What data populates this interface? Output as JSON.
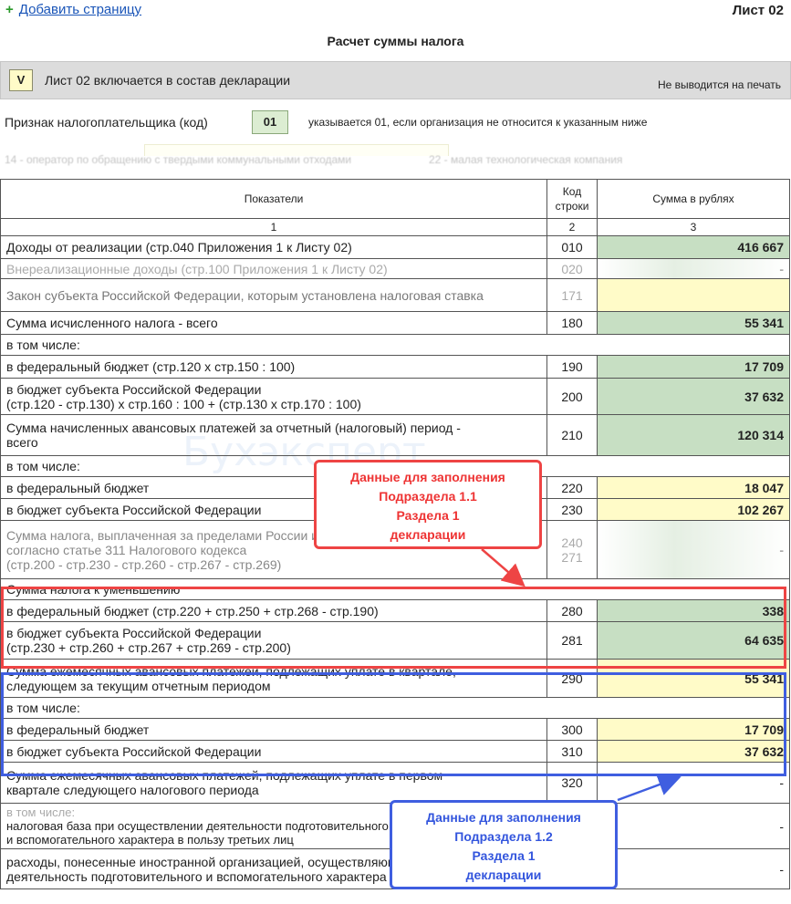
{
  "toolbar": {
    "add_page_icon": "plus-icon",
    "add_page_label": "Добавить страницу",
    "sheet_label": "Лист 02"
  },
  "title": "Расчет суммы налога",
  "include": {
    "checkbox_value": "V",
    "label": "Лист 02 включается в состав декларации",
    "noprint": "Не выводится на печать"
  },
  "taxpayer": {
    "label": "Признак налогоплательщика (код)",
    "code": "01",
    "hint": "указывается 01, если организация не относится к указанным ниже"
  },
  "faded_hints": {
    "left": "14 - оператор по обращению с твердыми коммунальными отходами",
    "right": "22 - малая технологическая компания"
  },
  "table": {
    "headers": {
      "indicators": "Показатели",
      "code_line1": "Код",
      "code_line2": "строки",
      "sum": "Сумма в рублях"
    },
    "col_numbers": [
      "1",
      "2",
      "3"
    ],
    "rows": [
      {
        "label": "Доходы от реализации (стр.040 Приложения 1 к Листу 02)",
        "code": "010",
        "value": "416 667"
      },
      {
        "label": "Внереализационные доходы (стр.100 Приложения 1 к Листу 02)",
        "code": "020",
        "value": "-"
      },
      {
        "label": "Закон субъекта Российской Федерации, которым установлена налоговая ставка",
        "code": "171",
        "value": ""
      },
      {
        "label": "Сумма исчисленного налога - всего",
        "code": "180",
        "value": "55 341"
      },
      {
        "label": "в том числе:"
      },
      {
        "label": "в федеральный бюджет (стр.120 х стр.150 : 100)",
        "code": "190",
        "value": "17 709"
      },
      {
        "label": "в бюджет субъекта Российской Федерации",
        "label2": "(стр.120 - стр.130) х стр.160 : 100 + (стр.130 х стр.170 : 100)",
        "code": "200",
        "value": "37 632"
      },
      {
        "label": "Сумма начисленных авансовых платежей за отчетный (налоговый) период -",
        "label2": "всего",
        "code": "210",
        "value": "120 314"
      },
      {
        "label": "в том числе:"
      },
      {
        "label": "в федеральный бюджет",
        "code": "220",
        "value": "18 047"
      },
      {
        "label": "в бюджет субъекта Российской Федерации",
        "code": "230",
        "value": "102 267"
      },
      {
        "label": "Сумма налога, выплаченная за пределами России и засчитываемая в уплату налога согласно статье 311 Налогового кодекса",
        "label2": "(стр.200 - стр.230 - стр.260 - стр.267 - стр.269)",
        "code": "240",
        "code2": "271",
        "value": "-"
      },
      {
        "label": "Сумма налога к уменьшению"
      },
      {
        "label": "в федеральный бюджет (стр.220 + стр.250 + стр.268 - стр.190)",
        "code": "280",
        "value": "338"
      },
      {
        "label": "в бюджет субъекта Российской Федерации",
        "label2": "(стр.230 + стр.260 + стр.267 + стр.269 - стр.200)",
        "code": "281",
        "value": "64 635"
      },
      {
        "label": "Сумма ежемесячных авансовых платежей, подлежащих уплате в квартале,",
        "label2": "следующем за текущим отчетным периодом",
        "code": "290",
        "value": "55 341"
      },
      {
        "label": "в том числе:"
      },
      {
        "label": "в федеральный бюджет",
        "code": "300",
        "value": "17 709"
      },
      {
        "label": "в бюджет субъекта Российской Федерации",
        "code": "310",
        "value": "37 632"
      },
      {
        "label": "Сумма ежемесячных авансовых платежей, подлежащих уплате в первом",
        "label2": "квартале следующего налогового периода",
        "code": "320",
        "value": "-"
      },
      {
        "label": "в том числе:",
        "label2": "налоговая база при осуществлении деятельности подготовительного",
        "label3": "и вспомогательного характера в пользу третьих лиц",
        "value": "-"
      },
      {
        "label": "расходы, понесенные иностранной организацией, осуществляющей",
        "label2": "деятельность подготовительного и вспомогательного характера",
        "value": "-"
      }
    ]
  },
  "callouts": {
    "red": [
      "Данные для заполнения",
      "Подраздела 1.1",
      "Раздела 1",
      "декларации"
    ],
    "blue": [
      "Данные для заполнения",
      "Подраздела 1.2",
      "Раздела 1",
      "декларации"
    ]
  },
  "watermark": "Бухэксперт",
  "colors": {
    "green_cell": "#c7dfc3",
    "yellow_cell": "#fffbc8",
    "red_accent": "#ee4444",
    "blue_accent": "#3f5ee0",
    "link": "#1a55b8"
  }
}
